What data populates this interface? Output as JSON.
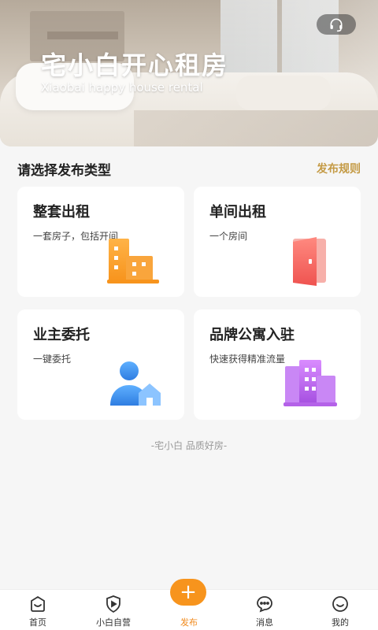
{
  "banner": {
    "title": "宅小白开心租房",
    "subtitle": "Xiaobai happy house rental",
    "service_icon": "headset-icon"
  },
  "section": {
    "title": "请选择发布类型",
    "rules_link": "发布规则"
  },
  "cards": [
    {
      "title": "整套出租",
      "desc": "一套房子，包括开间",
      "icon": "building-icon",
      "color": "#f7941d"
    },
    {
      "title": "单间出租",
      "desc": "一个房间",
      "icon": "door-icon",
      "color": "#f0605a"
    },
    {
      "title": "业主委托",
      "desc": "一键委托",
      "icon": "owner-house-icon",
      "color": "#3a8ef0"
    },
    {
      "title": "品牌公寓入驻",
      "desc": "快速获得精准流量",
      "icon": "apartment-icon",
      "color": "#b85ee8"
    }
  ],
  "footer_note": "-宅小白 品质好房-",
  "tabbar": {
    "items": [
      {
        "label": "首页",
        "icon": "home-icon"
      },
      {
        "label": "小白自营",
        "icon": "shield-play-icon"
      },
      {
        "label": "发布",
        "icon": "plus-icon",
        "symbol": "+"
      },
      {
        "label": "消息",
        "icon": "chat-icon"
      },
      {
        "label": "我的",
        "icon": "smile-icon"
      }
    ],
    "active_color": "#f08a1c",
    "accent": "#f7941d"
  }
}
